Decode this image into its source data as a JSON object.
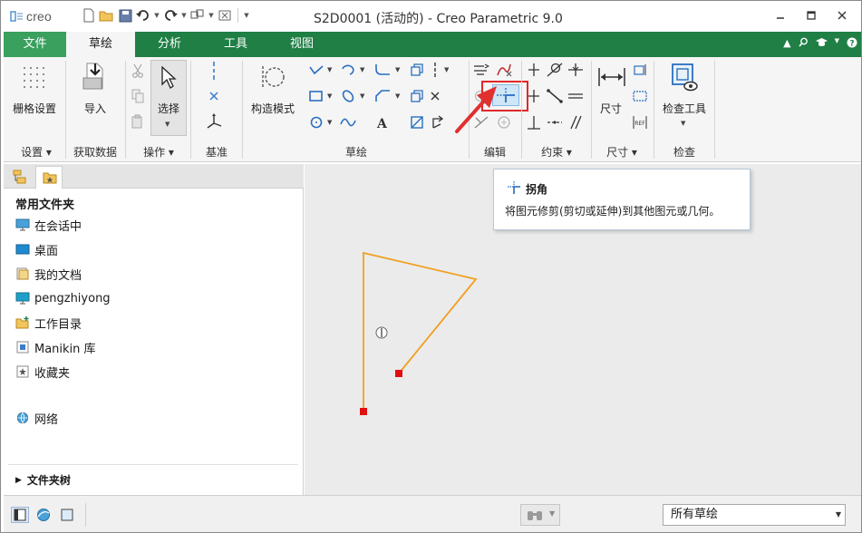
{
  "app": {
    "logo_text": "creo",
    "window_title": "S2D0001 (活动的) - Creo Parametric 9.0"
  },
  "tabs": [
    {
      "label": "文件"
    },
    {
      "label": "草绘"
    },
    {
      "label": "分析"
    },
    {
      "label": "工具"
    },
    {
      "label": "视图"
    }
  ],
  "ribbon": {
    "grid_settings": "栅格设置",
    "import": "导入",
    "select": "选择",
    "construction_mode": "构造模式",
    "dimension": "尺寸",
    "inspect_tools": "检查工具",
    "groups": {
      "settings": "设置",
      "get_data": "获取数据",
      "operations": "操作",
      "datum": "基准",
      "sketch": "草绘",
      "edit": "编辑",
      "constrain": "约束",
      "dimension": "尺寸",
      "inspect": "检查"
    }
  },
  "tooltip": {
    "title": "拐角",
    "description": "将图元修剪(剪切或延伸)到其他图元或几何。"
  },
  "left_panel": {
    "heading": "常用文件夹",
    "items": [
      {
        "label": "在会话中",
        "icon": "session-monitor-icon"
      },
      {
        "label": "桌面",
        "icon": "desktop-icon"
      },
      {
        "label": "我的文档",
        "icon": "documents-icon"
      },
      {
        "label": "pengzhiyong",
        "icon": "user-monitor-icon"
      },
      {
        "label": "工作目录",
        "icon": "working-dir-icon"
      },
      {
        "label": "Manikin 库",
        "icon": "manikin-library-icon"
      },
      {
        "label": "收藏夹",
        "icon": "favorites-icon"
      },
      {
        "label": "网络",
        "icon": "network-icon"
      }
    ],
    "folder_tree": "文件夹树"
  },
  "status_bar": {
    "filter_value": "所有草绘"
  },
  "colors": {
    "tab_bar": "#1f7f45",
    "file_tab": "#3aa05e",
    "sketch_line": "#f0a020",
    "endpoint": "#e01010",
    "highlight_box": "#e0282a",
    "arrow": "#e03030"
  }
}
